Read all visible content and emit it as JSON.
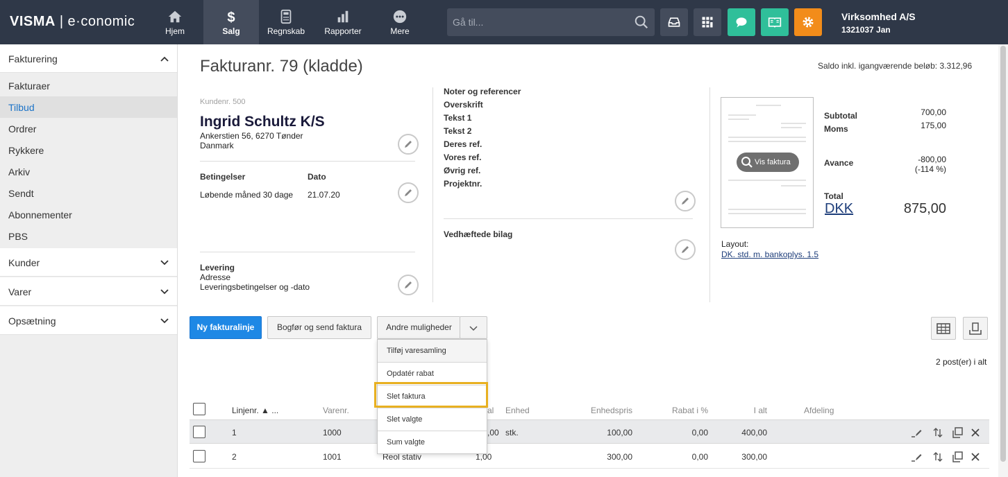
{
  "topbar": {
    "logo_brand": "VISMA",
    "logo_sep": "|",
    "logo_product": "e·conomic",
    "nav": [
      {
        "label": "Hjem",
        "icon": "home-icon"
      },
      {
        "label": "Salg",
        "icon": "dollar-icon"
      },
      {
        "label": "Regnskab",
        "icon": "calculator-icon"
      },
      {
        "label": "Rapporter",
        "icon": "bar-chart-icon"
      },
      {
        "label": "Mere",
        "icon": "more-icon"
      }
    ],
    "search_placeholder": "Gå til...",
    "company_name": "Virksomhed A/S",
    "company_sub": "1321037 Jan",
    "colors": {
      "bar": "#2f3848",
      "active": "#444c5c",
      "green": "#2fbf9a",
      "orange": "#f28c1a"
    }
  },
  "sidebar": {
    "sections": [
      {
        "label": "Fakturering",
        "expanded": true
      },
      {
        "label": "Kunder",
        "expanded": false
      },
      {
        "label": "Varer",
        "expanded": false
      },
      {
        "label": "Opsætning",
        "expanded": false
      }
    ],
    "items": [
      {
        "label": "Fakturaer"
      },
      {
        "label": "Tilbud",
        "active": true
      },
      {
        "label": "Ordrer"
      },
      {
        "label": "Rykkere"
      },
      {
        "label": "Arkiv"
      },
      {
        "label": "Sendt"
      },
      {
        "label": "Abonnementer"
      },
      {
        "label": "PBS"
      }
    ]
  },
  "invoice": {
    "title": "Fakturanr. 79 (kladde)",
    "saldo": "Saldo inkl. igangværende beløb: 3.312,96",
    "customer_no": "Kundenr. 500",
    "customer_name": "Ingrid Schultz K/S",
    "address1": "Ankerstien 56, 6270 Tønder",
    "address2": "Danmark",
    "terms_label": "Betingelser",
    "terms_value": "Løbende måned 30 dage",
    "date_label": "Dato",
    "date_value": "21.07.20",
    "delivery_label": "Levering",
    "delivery_address": "Adresse",
    "delivery_terms": "Leveringsbetingelser og -dato",
    "notes": [
      "Noter og referencer",
      "Overskrift",
      "Tekst 1",
      "Tekst 2",
      "Deres ref.",
      "Vores ref.",
      "Øvrig ref.",
      "Projektnr."
    ],
    "attachments_label": "Vedhæftede bilag",
    "preview_button": "Vis faktura",
    "layout_label": "Layout:",
    "layout_value": "DK. std. m. bankoplys. 1.5",
    "subtotal_label": "Subtotal",
    "subtotal_value": "700,00",
    "moms_label": "Moms",
    "moms_value": "175,00",
    "avance_label": "Avance",
    "avance_value": "-800,00",
    "avance_pct": "(-114 %)",
    "total_label": "Total",
    "currency": "DKK",
    "total_value": "875,00"
  },
  "toolbar": {
    "new_line": "Ny fakturalinje",
    "book_send": "Bogfør og send faktura",
    "more_options": "Andre muligheder",
    "dropdown": [
      "Tilføj varesamling",
      "Opdatér rabat",
      "Slet faktura",
      "Slet valgte",
      "Sum valgte"
    ],
    "count_text": "2 post(er) i alt",
    "highlight_color": "#e8b021"
  },
  "table": {
    "headers": {
      "linjenr": "Linjenr. ▲ ...",
      "varenr": "Varenr.",
      "antal": "al",
      "enhed": "Enhed",
      "enhedspris": "Enhedspris",
      "rabat": "Rabat i %",
      "ialt": "I alt",
      "afdeling": "Afdeling"
    },
    "rows": [
      {
        "linjenr": "1",
        "varenr": "1000",
        "tekst": "",
        "antal": ",00",
        "enhed": "stk.",
        "enhedspris": "100,00",
        "rabat": "0,00",
        "ialt": "400,00"
      },
      {
        "linjenr": "2",
        "varenr": "1001",
        "tekst": "Reol stativ",
        "antal": "1,00",
        "enhed": "",
        "enhedspris": "300,00",
        "rabat": "0,00",
        "ialt": "300,00"
      }
    ]
  }
}
